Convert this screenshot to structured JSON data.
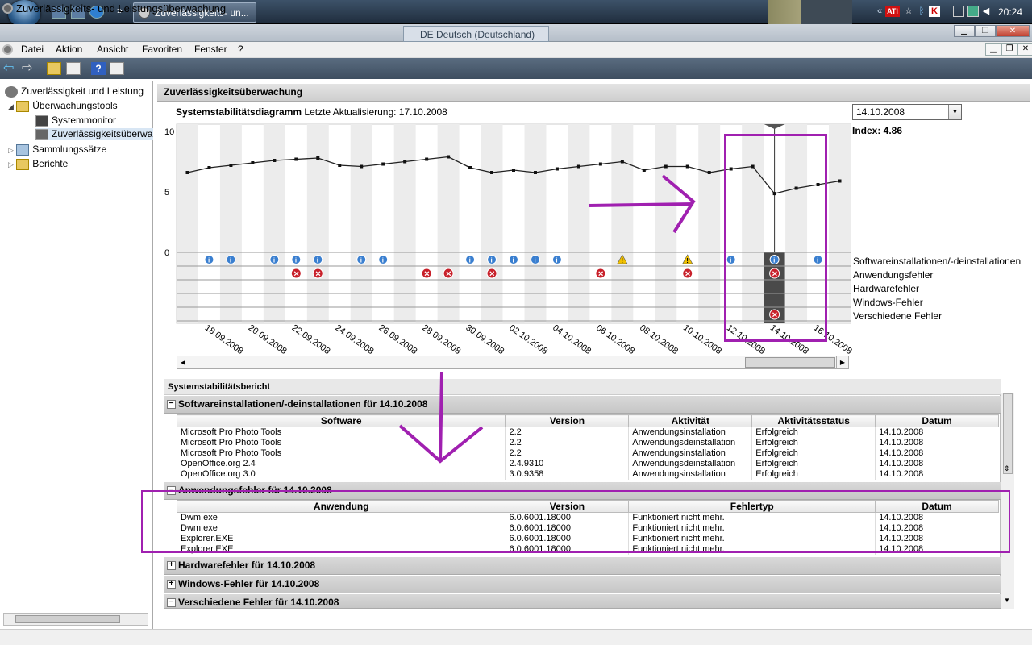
{
  "taskbar": {
    "task_label": "Zuverlässigkeits- un...",
    "clock": "20:24",
    "chevron": "»",
    "tray_icons": [
      "ati-icon",
      "star-icon",
      "bluetooth-icon",
      "antivirus-icon",
      "device-icon",
      "network-icon",
      "volume-icon"
    ],
    "ati_label": "ATI"
  },
  "window": {
    "title": "Zuverlässigkeits- und Leistungsüberwachung",
    "language_bar": "DE Deutsch (Deutschland)"
  },
  "menu": {
    "items": [
      "Datei",
      "Aktion",
      "Ansicht",
      "Favoriten",
      "Fenster",
      "?"
    ]
  },
  "tree": {
    "root": "Zuverlässigkeit und Leistung",
    "tools": "Überwachungstools",
    "sysmon": "Systemmonitor",
    "reliability": "Zuverlässigkeitsüberwa",
    "collections": "Sammlungssätze",
    "reports": "Berichte"
  },
  "main": {
    "header": "Zuverlässigkeitsüberwachung",
    "chart_title_bold": "Systemstabilitätsdiagramm",
    "chart_title_rest": " Letzte Aktualisierung: 17.10.2008",
    "selected_date": "14.10.2008",
    "index_label": "Index: 4.86"
  },
  "chart_data": {
    "type": "line",
    "title": "Systemstabilitätsdiagramm",
    "ylim": [
      0,
      10
    ],
    "yticks": [
      "10",
      "5",
      "0"
    ],
    "x": [
      "17.09",
      "18.09",
      "19.09",
      "20.09",
      "21.09",
      "22.09",
      "23.09",
      "24.09",
      "25.09",
      "26.09",
      "27.09",
      "28.09",
      "29.09",
      "30.09",
      "01.10",
      "02.10",
      "03.10",
      "04.10",
      "05.10",
      "06.10",
      "07.10",
      "08.10",
      "09.10",
      "10.10",
      "11.10",
      "12.10",
      "13.10",
      "14.10",
      "15.10",
      "16.10",
      "17.10"
    ],
    "values": [
      6.6,
      7.0,
      7.2,
      7.4,
      7.6,
      7.7,
      7.8,
      7.2,
      7.1,
      7.3,
      7.5,
      7.7,
      7.9,
      7.0,
      6.6,
      6.8,
      6.6,
      6.9,
      7.1,
      7.3,
      7.5,
      6.8,
      7.1,
      7.1,
      6.6,
      6.9,
      7.1,
      4.86,
      5.3,
      5.6,
      5.9
    ],
    "xtick_labels": [
      "18.09.2008",
      "20.09.2008",
      "22.09.2008",
      "24.09.2008",
      "26.09.2008",
      "28.09.2008",
      "30.09.2008",
      "02.10.2008",
      "04.10.2008",
      "06.10.2008",
      "08.10.2008",
      "10.10.2008",
      "12.10.2008",
      "14.10.2008",
      "16.10.2008"
    ],
    "event_rows": [
      "Softwareinstallationen/-deinstallationen",
      "Anwendungsfehler",
      "Hardwarefehler",
      "Windows-Fehler",
      "Verschiedene Fehler"
    ],
    "events": {
      "software_info": [
        "18.09",
        "19.09",
        "21.09",
        "22.09",
        "23.09",
        "25.09",
        "26.09",
        "30.09",
        "01.10",
        "02.10",
        "03.10",
        "04.10",
        "12.10",
        "14.10",
        "16.10"
      ],
      "software_warning": [
        "07.10",
        "10.10"
      ],
      "app_error": [
        "22.09",
        "23.09",
        "28.09",
        "29.09",
        "01.10",
        "06.10",
        "10.10",
        "14.10"
      ],
      "misc_error": [
        "14.10"
      ]
    },
    "selected_x": "14.10",
    "grid": true
  },
  "report": {
    "title": "Systemstabilitätsbericht",
    "software_section": "Softwareinstallationen/-deinstallationen für 14.10.2008",
    "software_headers": [
      "Software",
      "Version",
      "Aktivität",
      "Aktivitätsstatus",
      "Datum"
    ],
    "software_rows": [
      [
        "Microsoft Pro Photo Tools",
        "2.2",
        "Anwendungsinstallation",
        "Erfolgreich",
        "14.10.2008"
      ],
      [
        "Microsoft Pro Photo Tools",
        "2.2",
        "Anwendungsdeinstallation",
        "Erfolgreich",
        "14.10.2008"
      ],
      [
        "Microsoft Pro Photo Tools",
        "2.2",
        "Anwendungsinstallation",
        "Erfolgreich",
        "14.10.2008"
      ],
      [
        "OpenOffice.org 2.4",
        "2.4.9310",
        "Anwendungsdeinstallation",
        "Erfolgreich",
        "14.10.2008"
      ],
      [
        "OpenOffice.org 3.0",
        "3.0.9358",
        "Anwendungsinstallation",
        "Erfolgreich",
        "14.10.2008"
      ]
    ],
    "app_section": "Anwendungsfehler für 14.10.2008",
    "app_headers": [
      "Anwendung",
      "Version",
      "Fehlertyp",
      "Datum"
    ],
    "app_rows": [
      [
        "Dwm.exe",
        "6.0.6001.18000",
        "Funktioniert nicht mehr.",
        "14.10.2008"
      ],
      [
        "Dwm.exe",
        "6.0.6001.18000",
        "Funktioniert nicht mehr.",
        "14.10.2008"
      ],
      [
        "Explorer.EXE",
        "6.0.6001.18000",
        "Funktioniert nicht mehr.",
        "14.10.2008"
      ],
      [
        "Explorer.EXE",
        "6.0.6001.18000",
        "Funktioniert nicht mehr.",
        "14.10.2008"
      ]
    ],
    "hw_section": "Hardwarefehler für 14.10.2008",
    "win_section": "Windows-Fehler für 14.10.2008",
    "misc_section": "Verschiedene Fehler für 14.10.2008"
  },
  "colors": {
    "annotation": "#a020b0",
    "info": "#3a7fd0",
    "error": "#c8202a",
    "warning": "#f0c000",
    "selected_col": "#4a4a4a"
  }
}
